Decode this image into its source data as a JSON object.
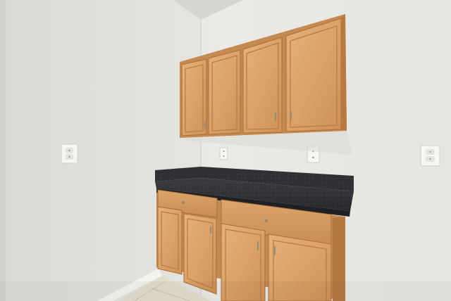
{
  "scene": {
    "description_colors": {
      "left_wall": "#e3e1dc",
      "back_wall": "#e9e8e4",
      "ceiling": "#d9d8d4",
      "cabinet_wood": "#d49a60",
      "cabinet_wood_dark": "#b97a40",
      "countertop": "#2f3134",
      "floor": "#ddd6c6",
      "baseboard": "#f4f3ef",
      "outlet": "#f5f5f2"
    },
    "elements": [
      "upper-cabinets",
      "lower-cabinets",
      "countertop",
      "wall-outlets",
      "baseboard",
      "floor-tile"
    ]
  }
}
